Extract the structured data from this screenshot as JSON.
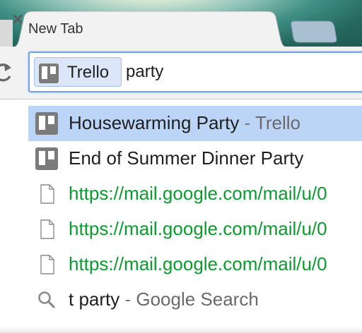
{
  "tab": {
    "title": "New Tab",
    "close_icon": "close-icon"
  },
  "toolbar": {
    "reload_icon": "reload-icon"
  },
  "omnibox": {
    "keyword_chip_label": "Trello",
    "keyword_icon": "trello-icon",
    "query": "party",
    "border_color": "#6fa3f0"
  },
  "suggestions": [
    {
      "icon": "trello-icon",
      "title": "Housewarming Party",
      "separator": " - ",
      "source": "Trello",
      "selected": true
    },
    {
      "icon": "trello-icon",
      "title": "End of Summer Dinner Party",
      "selected": false
    },
    {
      "icon": "page-icon",
      "url": "https://mail.google.com/mail/u/0",
      "selected": false
    },
    {
      "icon": "page-icon",
      "url": "https://mail.google.com/mail/u/0",
      "selected": false
    },
    {
      "icon": "page-icon",
      "url": "https://mail.google.com/mail/u/0",
      "selected": false
    },
    {
      "icon": "search-icon",
      "query": "t party",
      "separator": " - ",
      "source": "Google Search",
      "selected": false
    }
  ],
  "colors": {
    "selected_row": "#bcd5f7",
    "url_text": "#0a9c2e",
    "secondary_text": "#6a6a6a"
  }
}
